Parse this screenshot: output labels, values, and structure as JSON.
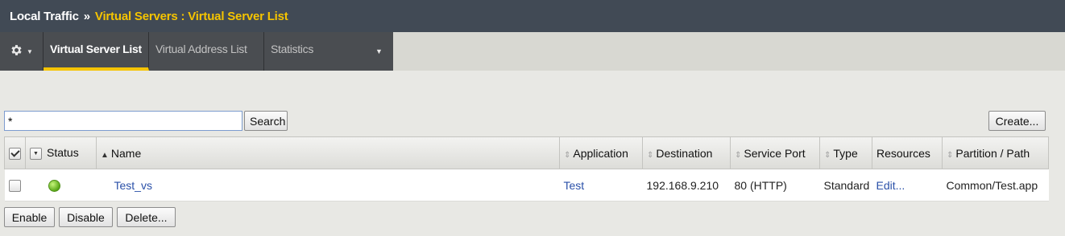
{
  "header": {
    "crumb_root": "Local Traffic",
    "crumb_sep": "»",
    "crumb_current": "Virtual Servers : Virtual Server List",
    "colors": {
      "bg": "#414a55",
      "accent": "#f5c400"
    }
  },
  "tabs": {
    "gear_icon": "gear-icon",
    "items": [
      {
        "label": "Virtual Server List",
        "active": true
      },
      {
        "label": "Virtual Address List",
        "active": false
      },
      {
        "label": "Statistics",
        "active": false
      }
    ]
  },
  "search": {
    "value": "*",
    "button_label": "Search"
  },
  "create_label": "Create...",
  "table": {
    "headers": {
      "status": "Status",
      "name": "Name",
      "application": "Application",
      "destination": "Destination",
      "service_port": "Service Port",
      "type": "Type",
      "resources": "Resources",
      "partition_path": "Partition / Path"
    },
    "rows": [
      {
        "status": "green",
        "name": "Test_vs",
        "application": "Test",
        "destination": "192.168.9.210",
        "service_port": "80 (HTTP)",
        "type": "Standard",
        "resources": "Edit...",
        "partition_path": "Common/Test.app"
      }
    ]
  },
  "actions": {
    "enable": "Enable",
    "disable": "Disable",
    "delete": "Delete..."
  }
}
